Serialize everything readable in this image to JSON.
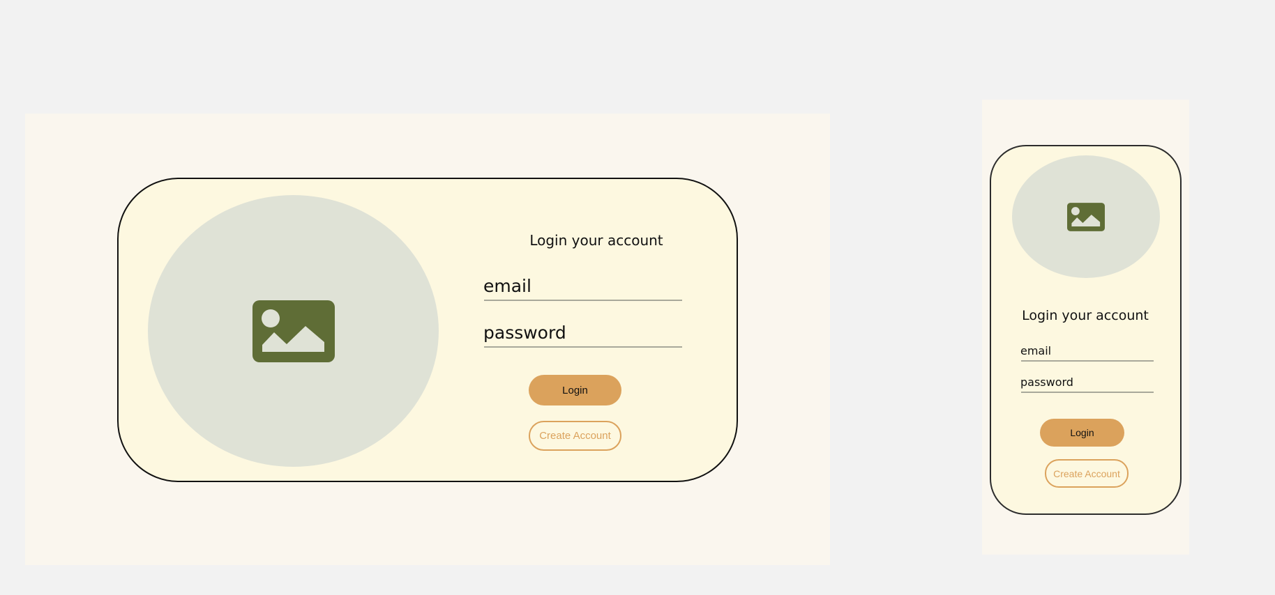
{
  "desktop": {
    "title": "Login your account",
    "email_placeholder": "email",
    "password_placeholder": "password",
    "login_label": "Login",
    "create_account_label": "Create Account"
  },
  "mobile": {
    "title": "Login your account",
    "email_placeholder": "email",
    "password_placeholder": "password",
    "login_label": "Login",
    "create_account_label": "Create Account"
  },
  "icons": {
    "image_placeholder": "image-icon"
  },
  "colors": {
    "page_background": "#f2f2f2",
    "frame_background": "#faf6ee",
    "card_background": "#fdf8e0",
    "image_circle": "#dfe2d6",
    "icon": "#5f6d36",
    "accent": "#dba25c",
    "field_underline": "#a8a89a"
  }
}
